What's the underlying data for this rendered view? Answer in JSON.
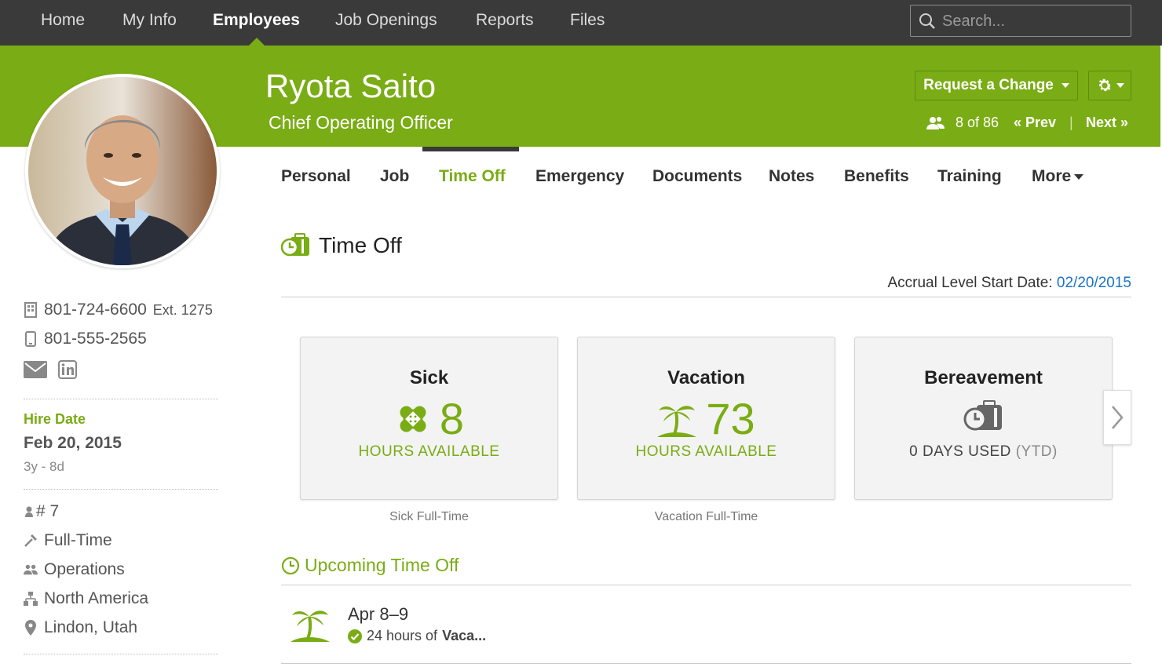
{
  "nav": {
    "items": [
      "Home",
      "My Info",
      "Employees",
      "Job Openings",
      "Reports",
      "Files"
    ],
    "active": "Employees",
    "search_placeholder": "Search..."
  },
  "employee": {
    "name": "Ryota Saito",
    "title": "Chief Operating Officer",
    "avatar_icon": "person-photo"
  },
  "actions": {
    "request_change": "Request a Change",
    "settings_icon": "gear-icon"
  },
  "pager": {
    "count": "8 of 86",
    "prev": "« Prev",
    "separator": "|",
    "next": "Next »"
  },
  "contact": {
    "work_phone": "801-724-6600",
    "work_ext": "Ext. 1275",
    "mobile_phone": "801-555-2565"
  },
  "hire": {
    "label": "Hire Date",
    "date": "Feb 20, 2015",
    "tenure": "3y - 8d"
  },
  "details": {
    "employee_number": "# 7",
    "employment_status": "Full-Time",
    "department": "Operations",
    "division": "North America",
    "location": "Lindon, Utah"
  },
  "tabs": [
    "Personal",
    "Job",
    "Time Off",
    "Emergency",
    "Documents",
    "Notes",
    "Benefits",
    "Training",
    "More"
  ],
  "active_tab": "Time Off",
  "time_off": {
    "title": "Time Off",
    "accrual_label": "Accrual Level Start Date:",
    "accrual_date": "02/20/2015",
    "cards": [
      {
        "title": "Sick",
        "value": "8",
        "sub": "HOURS AVAILABLE",
        "caption": "Sick Full-Time",
        "icon": "bandage-icon"
      },
      {
        "title": "Vacation",
        "value": "73",
        "sub": "HOURS AVAILABLE",
        "caption": "Vacation Full-Time",
        "icon": "palm-tree-icon"
      },
      {
        "title": "Bereavement",
        "sub": "0 DAYS USED",
        "sub_extra": "(YTD)",
        "icon": "clock-suitcase-icon"
      }
    ]
  },
  "upcoming": {
    "title": "Upcoming Time Off",
    "items": [
      {
        "date": "Apr 8–9",
        "detail_prefix": "24 hours of",
        "detail_bold": "Vaca..."
      }
    ]
  },
  "colors": {
    "brand_green": "#7aac15",
    "nav_bg": "#3a3a3a",
    "link_blue": "#1a74c8"
  }
}
